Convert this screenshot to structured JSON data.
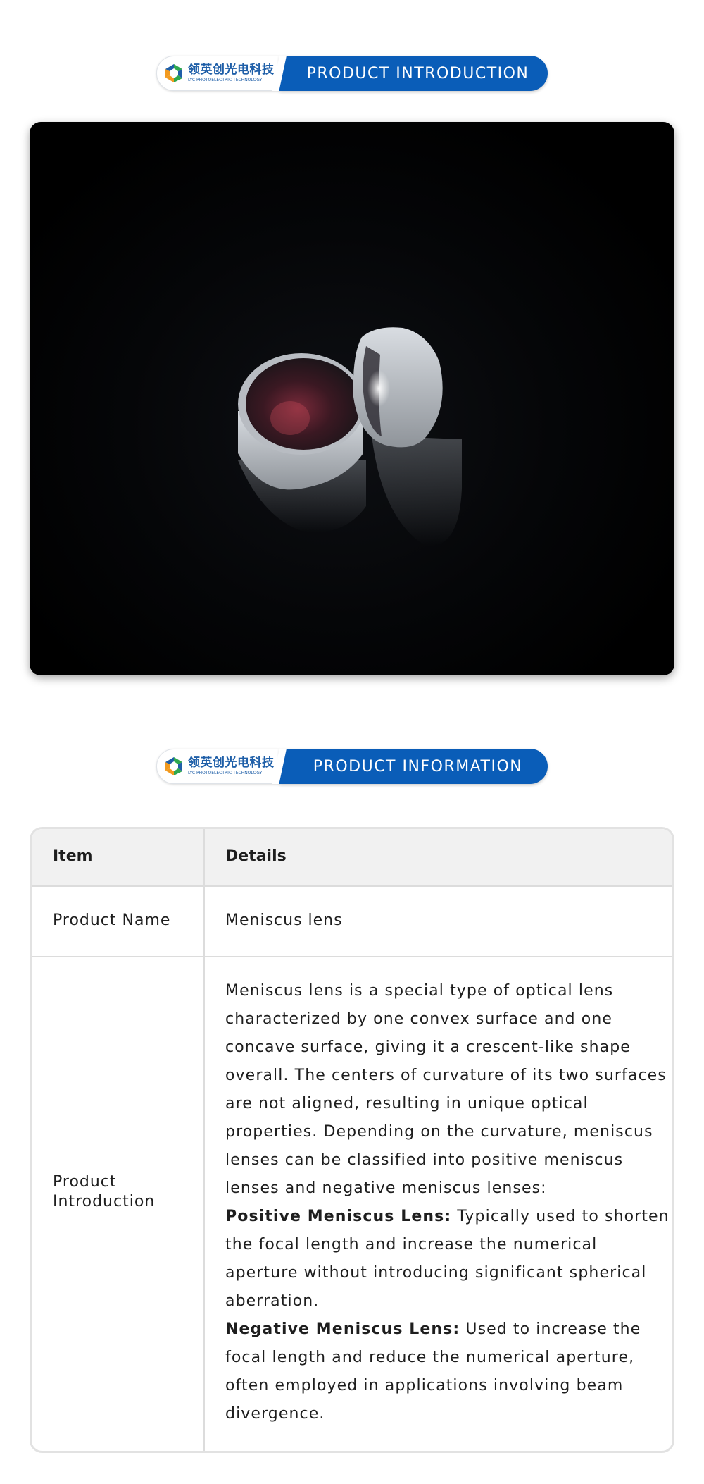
{
  "brand": {
    "name_cn": "领英创光电科技",
    "name_en": "LYC PHOTOELECTRIC TECHNOLOGY",
    "colors": {
      "primary": "#0a5db8",
      "logo_green": "#2fa84f",
      "logo_orange": "#f29a1f",
      "logo_blue": "#1f5fa8"
    }
  },
  "sections": [
    {
      "title": "PRODUCT INTRODUCTION"
    },
    {
      "title": "PRODUCT INFORMATION"
    }
  ],
  "product_image": {
    "icon": "meniscus-lens-photo"
  },
  "table": {
    "headers": {
      "item": "Item",
      "details": "Details"
    },
    "rows": [
      {
        "item": "Product Name",
        "details": "Meniscus lens"
      },
      {
        "item": "Product Introduction",
        "intro": "Meniscus lens is a special type of optical lens characterized by one convex surface and one concave surface, giving it a crescent-like shape overall. The centers of curvature of its two surfaces are not aligned, resulting in unique optical properties. Depending on the curvature, meniscus lenses can be classified into positive meniscus lenses and negative meniscus lenses:",
        "positive_label": "Positive Meniscus Lens:",
        "positive_text": " Typically used to shorten the focal length and increase the numerical aperture without introducing significant spherical aberration.",
        "negative_label": "Negative Meniscus Lens:",
        "negative_text": " Used to increase the focal length and reduce the numerical aperture, often employed in applications involving beam divergence."
      }
    ]
  }
}
